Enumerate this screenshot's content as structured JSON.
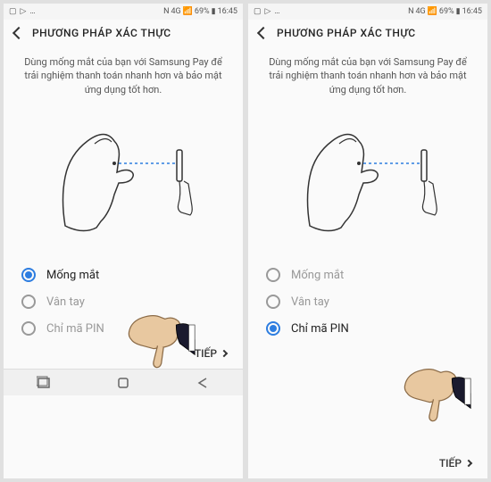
{
  "status": {
    "time": "16:45",
    "battery": "69%",
    "signal": "4G"
  },
  "header": {
    "title": "PHƯƠNG PHÁP XÁC THỰC"
  },
  "description": "Dùng mống mắt của bạn với Samsung Pay để trải nghiệm thanh toán nhanh hơn và bảo mật ứng dụng tốt hơn.",
  "options": {
    "iris": "Mống mắt",
    "fingerprint": "Vân tay",
    "pin": "Chỉ mã PIN"
  },
  "next_label": "TIẾP",
  "left_selected": "iris",
  "right_selected": "pin"
}
